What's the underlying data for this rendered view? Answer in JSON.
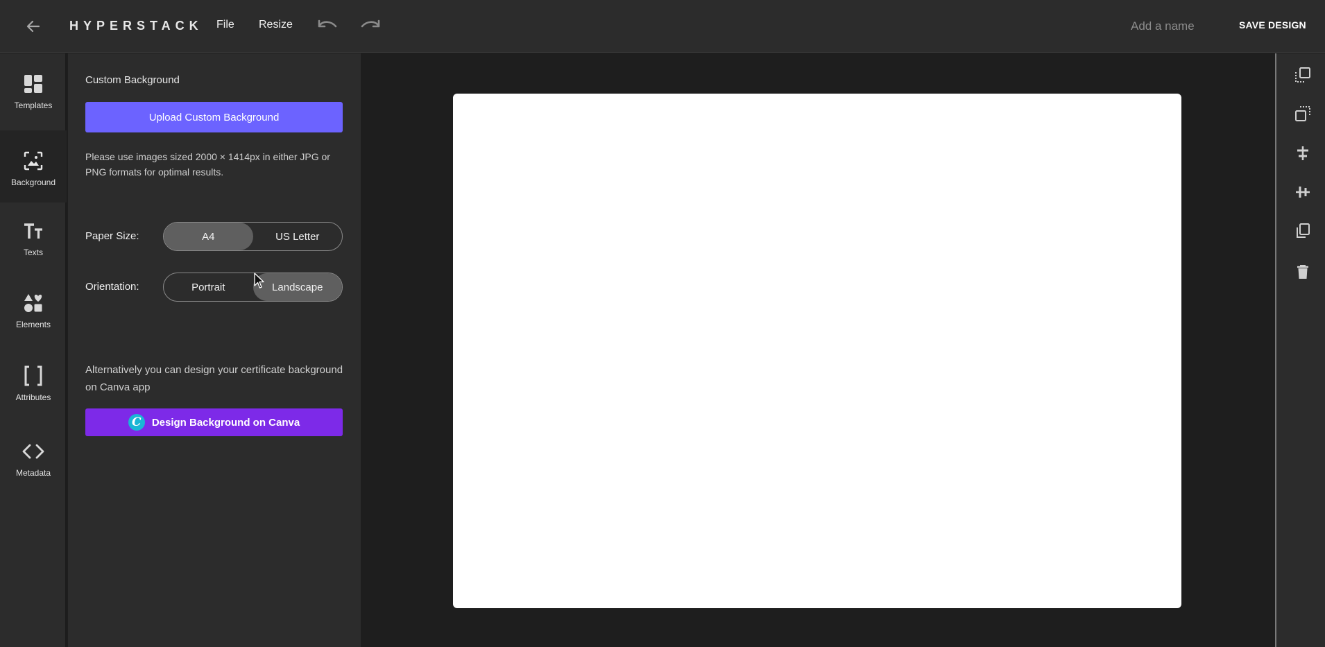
{
  "app": {
    "logo": "HYPERSTACK"
  },
  "topbar": {
    "menu": [
      {
        "label": "File"
      },
      {
        "label": "Resize"
      }
    ],
    "name_placeholder": "Add a name",
    "save_label": "SAVE DESIGN"
  },
  "leftnav": {
    "items": [
      {
        "label": "Templates",
        "icon": "templates-icon",
        "active": false
      },
      {
        "label": "Background",
        "icon": "background-icon",
        "active": true
      },
      {
        "label": "Texts",
        "icon": "texts-icon",
        "active": false
      },
      {
        "label": "Elements",
        "icon": "elements-icon",
        "active": false
      },
      {
        "label": "Attributes",
        "icon": "attributes-icon",
        "active": false
      },
      {
        "label": "Metadata",
        "icon": "metadata-icon",
        "active": false
      }
    ]
  },
  "panel": {
    "title": "Custom Background",
    "upload_label": "Upload Custom Background",
    "hint": "Please use images sized 2000 × 1414px in either JPG or PNG formats for optimal results.",
    "paper_size": {
      "label": "Paper Size:",
      "options": [
        "A4",
        "US Letter"
      ],
      "selected": "A4"
    },
    "orientation": {
      "label": "Orientation:",
      "options": [
        "Portrait",
        "Landscape"
      ],
      "selected": "Landscape"
    },
    "alt_text": "Alternatively you can design your certificate background on Canva app",
    "canva_label": "Design Background on Canva",
    "canva_logo": "C"
  },
  "rightbar": {
    "tools": [
      "bring-forward-icon",
      "send-backward-icon",
      "align-horizontal-center-icon",
      "align-vertical-center-icon",
      "duplicate-icon",
      "delete-icon"
    ]
  },
  "colors": {
    "accent": "#6c63ff",
    "canva": "#7d2ae8",
    "panel_bg": "#2c2c2c",
    "canvas_bg": "#1e1e1e",
    "paper": "#ffffff"
  }
}
